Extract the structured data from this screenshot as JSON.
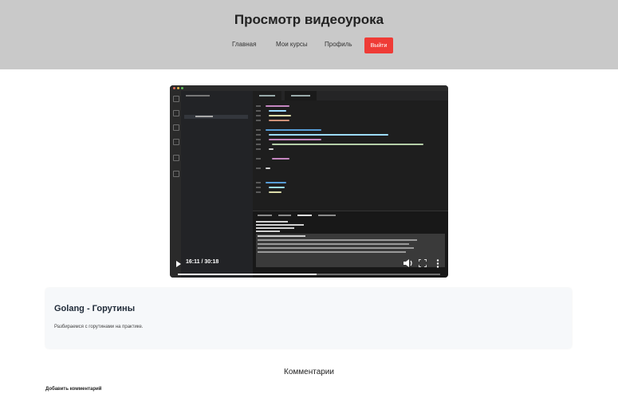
{
  "header": {
    "title": "Просмотр видеоурока",
    "nav": [
      {
        "label": "Главная"
      },
      {
        "label": "Мои курсы"
      },
      {
        "label": "Профиль"
      }
    ],
    "logout_label": "Выйти",
    "logout_color": "#ef3b36",
    "background": "#c9c9c9"
  },
  "player": {
    "time": "16:11 / 30:18",
    "progress": 0.53,
    "icons": [
      "play-icon",
      "volume-icon",
      "fullscreen-icon",
      "more-options-icon"
    ]
  },
  "lesson": {
    "title": "Golang - Горутины",
    "description": "Разбираемся с горутинами на практике."
  },
  "comments": {
    "heading": "Комментарии",
    "add_label": "Добавить комментарий"
  }
}
